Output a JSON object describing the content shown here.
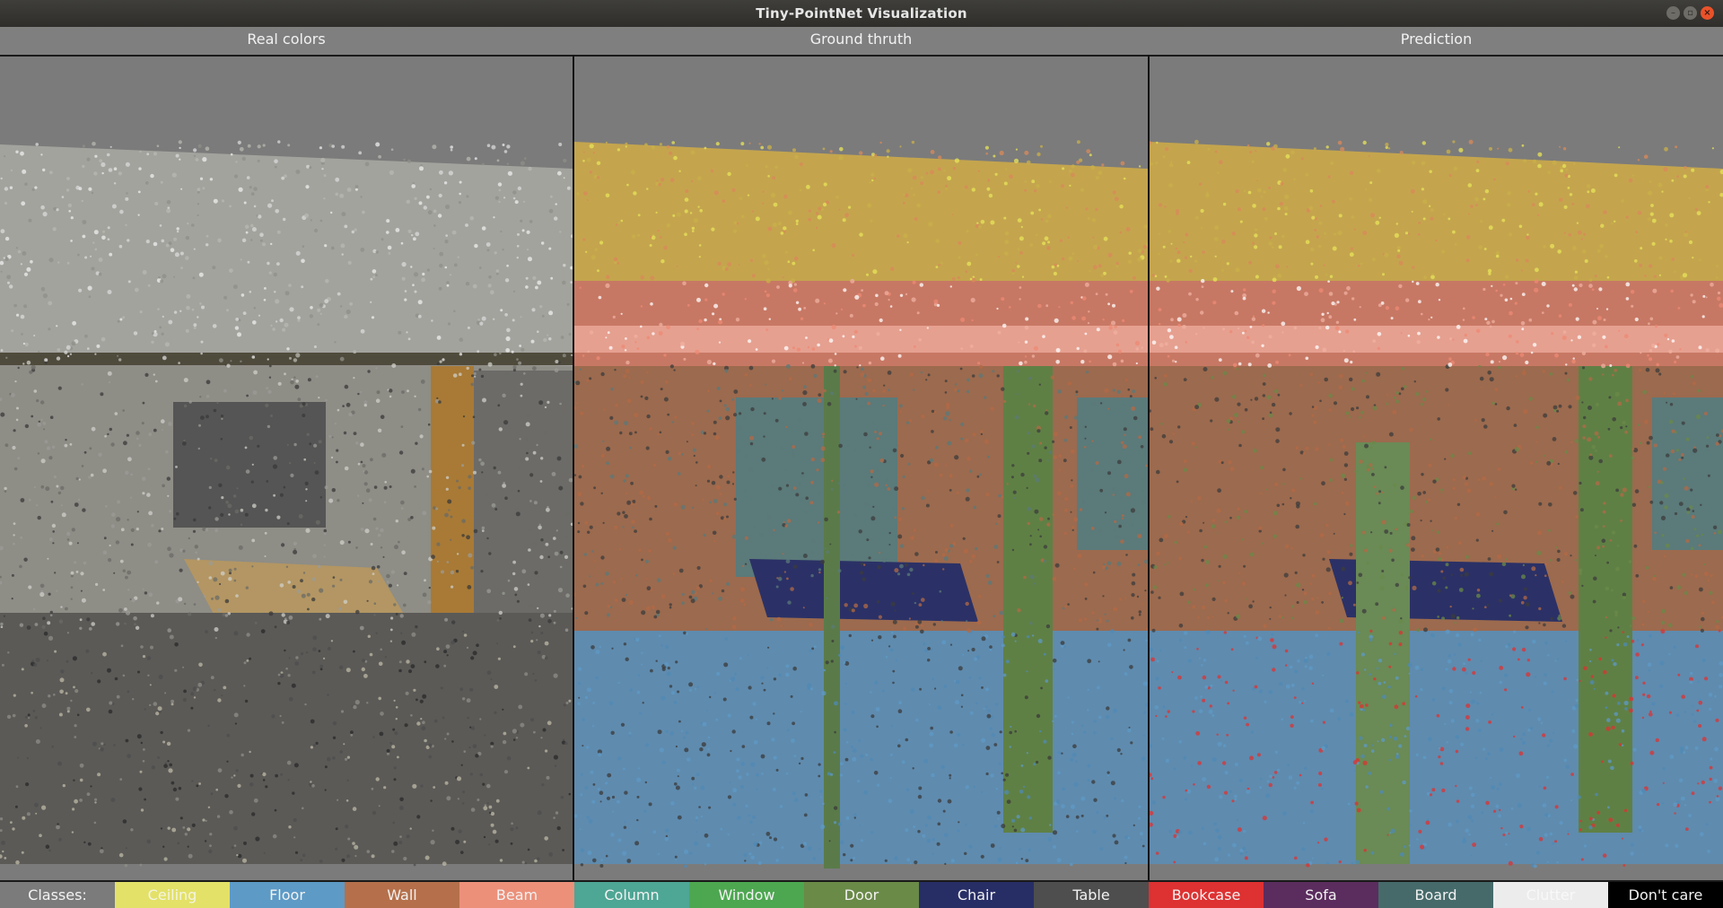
{
  "window": {
    "title": "Tiny-PointNet Visualization"
  },
  "panels": [
    {
      "title": "Real colors"
    },
    {
      "title": "Ground thruth"
    },
    {
      "title": "Prediction"
    }
  ],
  "legend": {
    "label": "Classes:",
    "classes": [
      {
        "name": "Ceiling",
        "color": "#e3e168",
        "text_color": "#f4f4e0"
      },
      {
        "name": "Floor",
        "color": "#5d9ac6",
        "text_color": "#f2f2f2"
      },
      {
        "name": "Wall",
        "color": "#b5704b",
        "text_color": "#f2f2f2"
      },
      {
        "name": "Beam",
        "color": "#ec907a",
        "text_color": "#f2f2f2"
      },
      {
        "name": "Column",
        "color": "#4ea694",
        "text_color": "#f2f2f2"
      },
      {
        "name": "Window",
        "color": "#4da750",
        "text_color": "#f2f2f2"
      },
      {
        "name": "Door",
        "color": "#6a8a48",
        "text_color": "#f2f2f2"
      },
      {
        "name": "Chair",
        "color": "#272e66",
        "text_color": "#f2f2f2"
      },
      {
        "name": "Table",
        "color": "#4e4e4e",
        "text_color": "#f2f2f2"
      },
      {
        "name": "Bookcase",
        "color": "#de3131",
        "text_color": "#f2f2f2"
      },
      {
        "name": "Sofa",
        "color": "#5b2c5e",
        "text_color": "#f2f2f2"
      },
      {
        "name": "Board",
        "color": "#466a6a",
        "text_color": "#f2f2f2"
      },
      {
        "name": "Clutter",
        "color": "#ececec",
        "text_color": "#f8f8f8"
      },
      {
        "name": "Don't care",
        "color": "#000000",
        "text_color": "#f2f2f2"
      }
    ]
  }
}
